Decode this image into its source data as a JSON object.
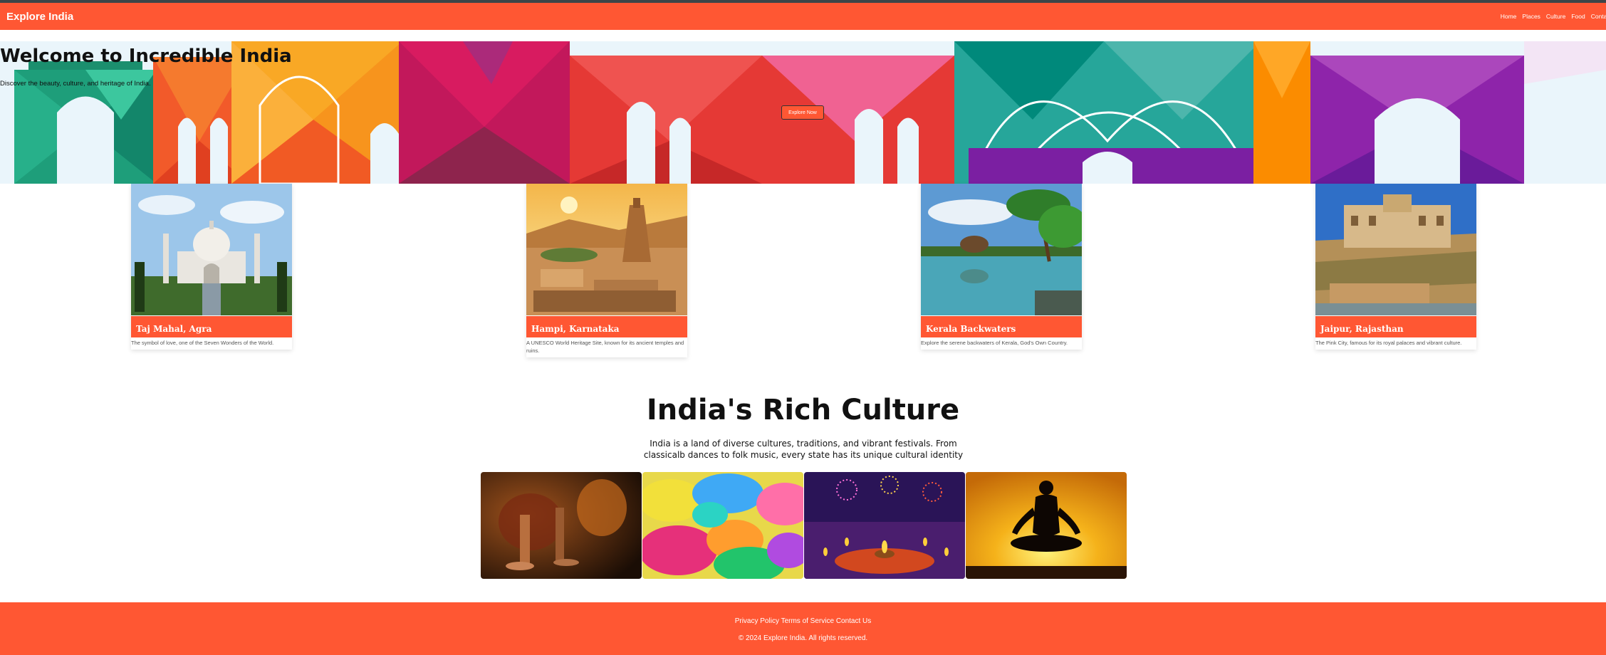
{
  "navbar": {
    "brand": "Explore India",
    "links": [
      "Home",
      "Places",
      "Culture",
      "Food",
      "Contact"
    ]
  },
  "hero": {
    "title": "Welcome to Incredible India",
    "subtitle": "Discover the beauty, culture, and heritage of India.",
    "button_label": "Explore Now"
  },
  "places": [
    {
      "name": "Taj Mahal, Agra",
      "description": "The symbol of love, one of the Seven Wonders of the World."
    },
    {
      "name": "Hampi, Karnataka",
      "description": "A UNESCO World Heritage Site, known for its ancient temples and ruins."
    },
    {
      "name": "Kerala Backwaters",
      "description": "Explore the serene backwaters of Kerala, God's Own Country."
    },
    {
      "name": "Jaipur, Rajasthan",
      "description": "The Pink City, famous for its royal palaces and vibrant culture."
    }
  ],
  "culture": {
    "title": "India's Rich Culture",
    "text": "India is a land of diverse cultures, traditions, and vibrant festivals. From classicalb dances to folk music, every state has its unique cultural identity"
  },
  "footer": {
    "links": [
      "Privacy Policy",
      "Terms of Service",
      "Contact Us"
    ],
    "copyright": "© 2024 Explore India. All rights reserved."
  },
  "colors": {
    "accent": "#ff5733",
    "topline": "#3d4548"
  }
}
